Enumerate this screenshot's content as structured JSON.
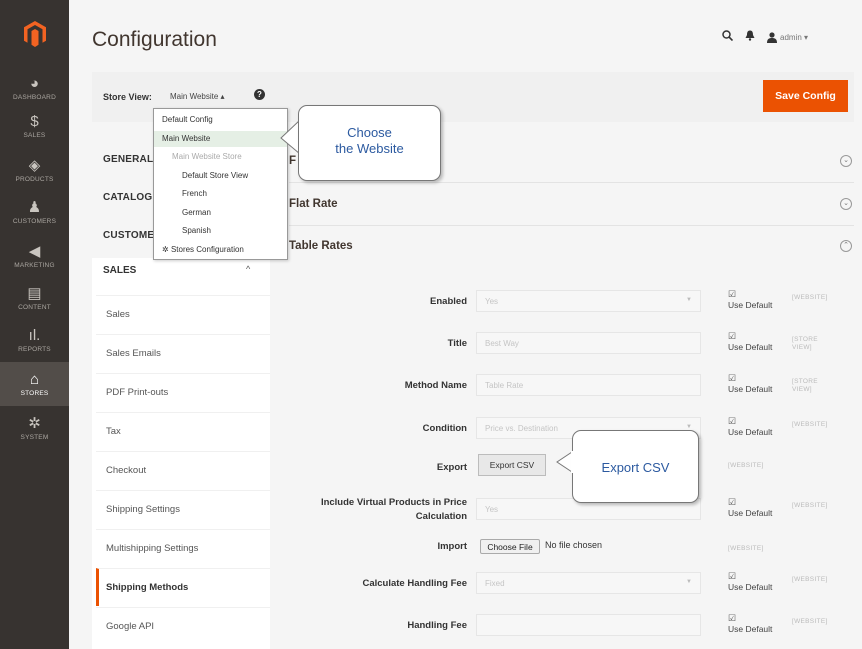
{
  "nav": {
    "items": [
      {
        "label": "DASHBOARD",
        "icon": "dashboard-icon",
        "glyph": "◕"
      },
      {
        "label": "SALES",
        "icon": "dollar-icon",
        "glyph": "$"
      },
      {
        "label": "PRODUCTS",
        "icon": "cube-icon",
        "glyph": "◈"
      },
      {
        "label": "CUSTOMERS",
        "icon": "person-icon",
        "glyph": "♟"
      },
      {
        "label": "MARKETING",
        "icon": "megaphone-icon",
        "glyph": "◀"
      },
      {
        "label": "CONTENT",
        "icon": "content-icon",
        "glyph": "▤"
      },
      {
        "label": "REPORTS",
        "icon": "reports-icon",
        "glyph": "ıl."
      },
      {
        "label": "STORES",
        "icon": "store-icon",
        "glyph": "⌂"
      },
      {
        "label": "SYSTEM",
        "icon": "gear-icon",
        "glyph": "✲"
      }
    ]
  },
  "header": {
    "title": "Configuration",
    "admin": "admin ▾"
  },
  "store": {
    "label": "Store View:",
    "value": "Main Website ▴",
    "save_label": "Save Config"
  },
  "dropdown": [
    {
      "label": "Default Config",
      "indent": 8,
      "hl": false,
      "dim": false
    },
    {
      "label": "Main Website",
      "indent": 8,
      "hl": true,
      "dim": false
    },
    {
      "label": "Main Website Store",
      "indent": 18,
      "hl": false,
      "dim": true
    },
    {
      "label": "Default Store View",
      "indent": 28,
      "hl": false,
      "dim": false
    },
    {
      "label": "French",
      "indent": 28,
      "hl": false,
      "dim": false
    },
    {
      "label": "German",
      "indent": 28,
      "hl": false,
      "dim": false
    },
    {
      "label": "Spanish",
      "indent": 28,
      "hl": false,
      "dim": false
    },
    {
      "label": "Stores Configuration",
      "indent": 8,
      "hl": false,
      "dim": false
    }
  ],
  "tabs": {
    "general": "GENERAL",
    "catalog": "CATALOG",
    "customers": "CUSTOMER",
    "sales": "SALES"
  },
  "sales_items": [
    "Sales",
    "Sales Emails",
    "PDF Print-outs",
    "Tax",
    "Checkout",
    "Shipping Settings",
    "Multishipping Settings",
    "Shipping Methods",
    "Google API"
  ],
  "sections": {
    "first": "F",
    "flat_rate": "Flat Rate",
    "table_rates": "Table Rates"
  },
  "form": {
    "use_default": "Use Default",
    "enabled": {
      "label": "Enabled",
      "value": "Yes",
      "scope": "[WEBSITE]"
    },
    "title": {
      "label": "Title",
      "value": "Best Way",
      "scope_1": "[STORE",
      "scope_2": "VIEW]"
    },
    "method_name": {
      "label": "Method Name",
      "value": "Table Rate",
      "scope_1": "[STORE",
      "scope_2": "VIEW]"
    },
    "condition": {
      "label": "Condition",
      "value": "Price vs. Destination",
      "scope": "[WEBSITE]"
    },
    "export": {
      "label": "Export",
      "button": "Export CSV",
      "scope": "[WEBSITE]"
    },
    "virtual": {
      "label_1": "Include Virtual Products in Price",
      "label_2": "Calculation",
      "value": "Yes",
      "scope": "[WEBSITE]"
    },
    "import": {
      "label": "Import",
      "button": "Choose File",
      "no_file": "No file chosen",
      "scope": "[WEBSITE]"
    },
    "handling_fee_calc": {
      "label": "Calculate Handling Fee",
      "value": "Fixed",
      "scope": "[WEBSITE]"
    },
    "handling_fee": {
      "label": "Handling Fee",
      "value": "",
      "scope": "[WEBSITE]"
    }
  },
  "callouts": {
    "choose_1": "Choose",
    "choose_2": "the Website",
    "export": "Export CSV"
  }
}
